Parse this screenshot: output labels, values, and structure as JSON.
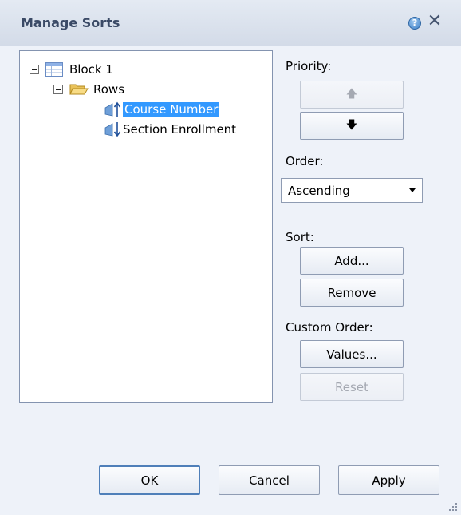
{
  "dialog": {
    "title": "Manage Sorts",
    "help_icon_glyph": "?",
    "close_icon_glyph": "✕"
  },
  "tree": {
    "block_label": "Block 1",
    "rows_label": "Rows",
    "items": [
      {
        "label": "Course Number",
        "direction": "ascending",
        "selected": true
      },
      {
        "label": "Section Enrollment",
        "direction": "descending",
        "selected": false
      }
    ]
  },
  "priority": {
    "label": "Priority:",
    "up_glyph": "🡅",
    "down_glyph": "🡇",
    "up_enabled": false,
    "down_enabled": true
  },
  "order": {
    "label": "Order:",
    "selected": "Ascending"
  },
  "sort": {
    "label": "Sort:",
    "add_label": "Add...",
    "remove_label": "Remove"
  },
  "custom_order": {
    "label": "Custom Order:",
    "values_label": "Values...",
    "reset_label": "Reset",
    "reset_enabled": false
  },
  "footer": {
    "ok_label": "OK",
    "cancel_label": "Cancel",
    "apply_label": "Apply"
  },
  "colors": {
    "selection": "#3399ff",
    "dialog_bg": "#eef2f9",
    "title_text": "#3b4a66"
  }
}
